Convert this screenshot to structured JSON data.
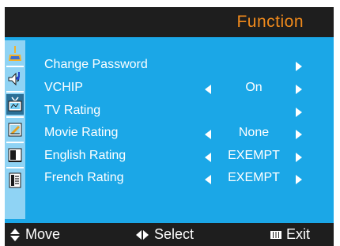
{
  "header": {
    "title": "Function"
  },
  "sidebar": {
    "items": [
      {
        "icon": "picture-icon"
      },
      {
        "icon": "sound-icon"
      },
      {
        "icon": "tv-icon"
      },
      {
        "icon": "setup-icon"
      },
      {
        "icon": "screen-icon"
      },
      {
        "icon": "document-icon"
      }
    ]
  },
  "menu": {
    "rows": [
      {
        "label": "Change Password",
        "value": ""
      },
      {
        "label": "VCHIP",
        "value": "On"
      },
      {
        "label": "TV Rating",
        "value": ""
      },
      {
        "label": "Movie Rating",
        "value": "None"
      },
      {
        "label": "English Rating",
        "value": "EXEMPT"
      },
      {
        "label": "French Rating",
        "value": "EXEMPT"
      }
    ]
  },
  "footer": {
    "move_label": "Move",
    "select_label": "Select",
    "exit_label": "Exit"
  }
}
